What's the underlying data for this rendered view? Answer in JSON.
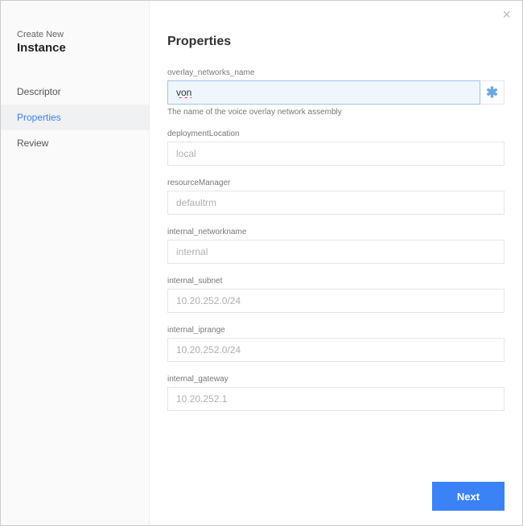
{
  "close_label": "×",
  "sidebar": {
    "sub": "Create New",
    "title": "Instance",
    "items": [
      {
        "label": "Descriptor",
        "active": false
      },
      {
        "label": "Properties",
        "active": true
      },
      {
        "label": "Review",
        "active": false
      }
    ]
  },
  "main": {
    "title": "Properties"
  },
  "fields": {
    "overlay": {
      "label": "overlay_networks_name",
      "value": "von",
      "required_mark": "✱",
      "help": "The name of the voice overlay network assembly"
    },
    "deploymentLocation": {
      "label": "deploymentLocation",
      "placeholder": "local"
    },
    "resourceManager": {
      "label": "resourceManager",
      "placeholder": "defaultrm"
    },
    "internal_networkname": {
      "label": "internal_networkname",
      "placeholder": "internal"
    },
    "internal_subnet": {
      "label": "internal_subnet",
      "placeholder": "10.20.252.0/24"
    },
    "internal_iprange": {
      "label": "internal_iprange",
      "placeholder": "10.20.252.0/24"
    },
    "internal_gateway": {
      "label": "internal_gateway",
      "placeholder": "10.20.252.1"
    }
  },
  "footer": {
    "next": "Next"
  }
}
